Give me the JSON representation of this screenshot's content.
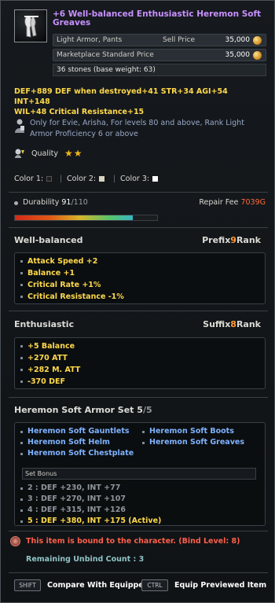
{
  "item": {
    "name": "+6 Well-balanced Enthusiastic Heremon Soft Greaves",
    "icon": "greaves-icon",
    "type_label": "Light Armor, Pants",
    "sell_label": "Sell Price",
    "sell_price": "35,000",
    "market_label": "Marketplace Standard Price",
    "market_price": "35,000",
    "weight": "36 stones (base weight: 63)"
  },
  "stats": {
    "line1": "DEF+889  DEF when destroyed+41  STR+34  AGI+54  INT+148",
    "line2": "WIL+48  Critical Resistance+15"
  },
  "restriction": {
    "line1": "Only for Evie, Arisha, For levels 80 and above, Rank Light",
    "line2": "Armor Proficiency 6 or above"
  },
  "quality": {
    "label": "Quality",
    "stars": "★★"
  },
  "colors": {
    "c1_label": "Color 1:",
    "c1": "#1e1e1e",
    "c2_label": "Color 2:",
    "c2": "#d8d3c1",
    "c3_label": "Color 3:",
    "c3": "#ffffff"
  },
  "durability": {
    "label": "Durability",
    "current": "91",
    "max": "/110",
    "fraction": 0.827,
    "repair_label": "Repair Fee",
    "repair_fee": "7039",
    "repair_unit": "G"
  },
  "prefix": {
    "title": "Well-balanced",
    "rank_label_pre": "Prefix",
    "rank": "9",
    "rank_label_post": "Rank",
    "lines": [
      "Attack Speed +2",
      "Balance +1",
      "Critical Rate +1%",
      "Critical Resistance -1%"
    ]
  },
  "suffix": {
    "title": "Enthusiastic",
    "rank_label_pre": "Suffix",
    "rank": "8",
    "rank_label_post": "Rank",
    "lines": [
      "+5 Balance",
      "+270 ATT",
      "+282 M. ATT",
      "-370 DEF"
    ]
  },
  "set": {
    "title": "Heremon Soft Armor Set",
    "count": "5",
    "count_total": "/5",
    "items_left": [
      "Heremon Soft Gauntlets",
      "Heremon Soft Helm",
      "Heremon Soft Chestplate"
    ],
    "items_right": [
      "Heremon Soft Boots",
      "Heremon Soft Greaves"
    ],
    "bonus_header": "Set Bonus",
    "bonuses": [
      "2 : DEF +230, INT +77",
      "3 : DEF +270, INT +107",
      "4 : DEF +315, INT +126",
      "5 : DEF +380, INT +175 (Active)"
    ]
  },
  "bound": {
    "text": "This item is bound to the character. (Bind Level: 8)",
    "unbind": "Remaining Unbind Count : 3"
  },
  "footer": {
    "shift_key": "SHIFT",
    "shift_label": "Compare With Equipped",
    "ctrl_key": "CTRL",
    "ctrl_label": "Equip Previewed Item"
  }
}
